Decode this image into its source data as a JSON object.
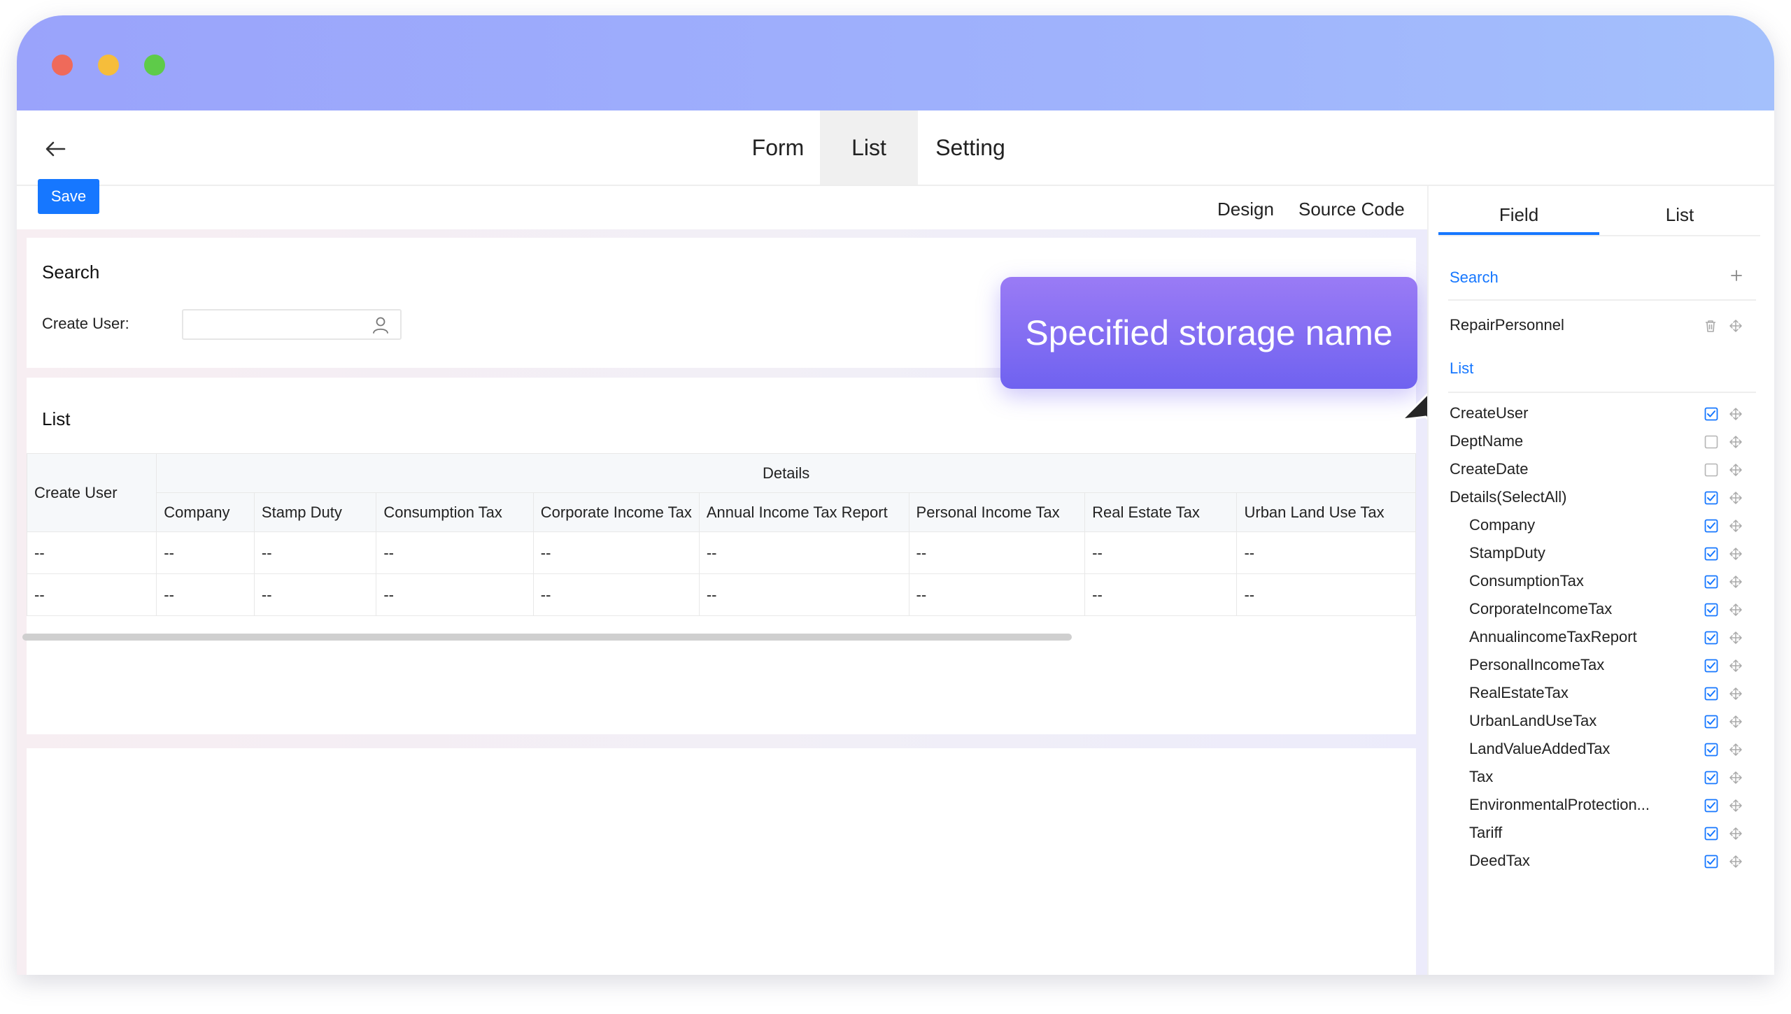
{
  "window": {
    "controls": [
      "close",
      "minimize",
      "maximize"
    ]
  },
  "nav": {
    "back_icon": "arrow-left-icon",
    "tabs": [
      {
        "label": "Form"
      },
      {
        "label": "List",
        "active": true
      },
      {
        "label": "Setting"
      }
    ]
  },
  "toolbar": {
    "save_label": "Save"
  },
  "editor_tabs": {
    "design": "Design",
    "source": "Source Code"
  },
  "search_panel": {
    "title": "Search",
    "field_label": "Create User:",
    "field_value": "",
    "field_icon": "user-icon"
  },
  "list_panel": {
    "title": "List",
    "headers": {
      "create_user": "Create User",
      "details": "Details",
      "columns": [
        "Company",
        "Stamp Duty",
        "Consumption Tax",
        "Corporate Income Tax",
        "Annual Income Tax Report",
        "Personal Income Tax",
        "Real Estate Tax",
        "Urban Land Use Tax"
      ]
    },
    "rows": [
      [
        "--",
        "--",
        "--",
        "--",
        "--",
        "--",
        "--",
        "--",
        "--"
      ],
      [
        "--",
        "--",
        "--",
        "--",
        "--",
        "--",
        "--",
        "--",
        "--"
      ]
    ]
  },
  "callout": {
    "text": "Specified storage name"
  },
  "right_panel": {
    "tabs": [
      {
        "label": "Field",
        "active": true
      },
      {
        "label": "List"
      }
    ],
    "search_section": "Search",
    "search_fields": [
      {
        "label": "RepairPersonnel"
      }
    ],
    "list_section": "List",
    "list_fields": [
      {
        "label": "CreateUser",
        "checked": true,
        "child": false
      },
      {
        "label": "DeptName",
        "checked": false,
        "child": false
      },
      {
        "label": "CreateDate",
        "checked": false,
        "child": false
      },
      {
        "label": "Details(SelectAll)",
        "checked": true,
        "child": false
      },
      {
        "label": "Company",
        "checked": true,
        "child": true
      },
      {
        "label": "StampDuty",
        "checked": true,
        "child": true
      },
      {
        "label": "ConsumptionTax",
        "checked": true,
        "child": true
      },
      {
        "label": "CorporateIncomeTax",
        "checked": true,
        "child": true
      },
      {
        "label": "AnnualincomeTaxReport",
        "checked": true,
        "child": true
      },
      {
        "label": "PersonalIncomeTax",
        "checked": true,
        "child": true
      },
      {
        "label": "RealEstateTax",
        "checked": true,
        "child": true
      },
      {
        "label": "UrbanLandUseTax",
        "checked": true,
        "child": true
      },
      {
        "label": "LandValueAddedTax",
        "checked": true,
        "child": true
      },
      {
        "label": "Tax",
        "checked": true,
        "child": true
      },
      {
        "label": "EnvironmentalProtection...",
        "checked": true,
        "child": true
      },
      {
        "label": "Tariff",
        "checked": true,
        "child": true
      },
      {
        "label": "DeedTax",
        "checked": true,
        "child": true
      }
    ]
  },
  "colors": {
    "accent": "#1677ff",
    "titlebar": "#9fb2fc",
    "callout": "#7a67f2"
  }
}
